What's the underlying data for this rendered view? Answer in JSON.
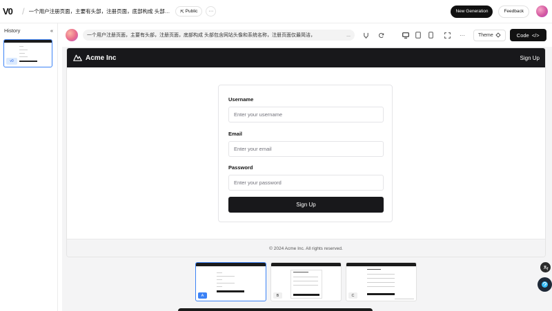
{
  "app": {
    "logo": "V0",
    "project_title": "一个用户注册页面，主要有头部，注册页面，底部构成 头部…",
    "visibility_label": "Public",
    "more_label": "···",
    "new_generation_label": "New Generation",
    "feedback_label": "Feedback"
  },
  "sidebar": {
    "title": "History",
    "collapse_icon": "«",
    "items": [
      {
        "badge": "v0"
      }
    ]
  },
  "toolbar": {
    "prompt_text": "一个用户注册页面，主要有头部，注册页面，底部构成 头部包含网站头像和系统名称，注册页面仅最简洁，",
    "prompt_more": "...",
    "theme_label": "Theme",
    "code_label": "Code",
    "more_label": "···"
  },
  "preview": {
    "brand": "Acme Inc",
    "header_signup": "Sign Up",
    "form": {
      "username_label": "Username",
      "username_placeholder": "Enter your username",
      "email_label": "Email",
      "email_placeholder": "Enter your email",
      "password_label": "Password",
      "password_placeholder": "Enter your password",
      "submit_label": "Sign Up"
    },
    "footer": "© 2024 Acme Inc. All rights reserved."
  },
  "variants": [
    {
      "badge": "A",
      "selected": true
    },
    {
      "badge": "B",
      "selected": false
    },
    {
      "badge": "C",
      "selected": false
    }
  ],
  "colors": {
    "accent": "#3b82f6",
    "dark": "#18181b"
  }
}
